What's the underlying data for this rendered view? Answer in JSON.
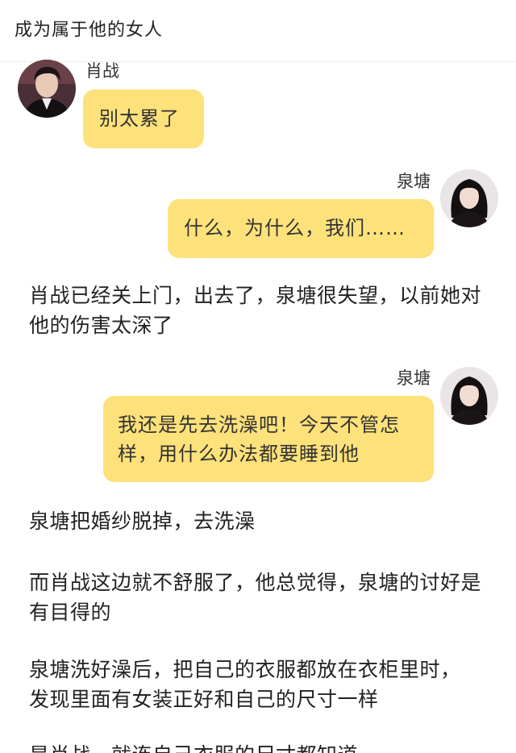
{
  "header": {
    "title": "成为属于他的女人"
  },
  "messages": [
    {
      "name": "肖战",
      "text": "别太累了",
      "avatar_icon": "male-portrait-avatar"
    },
    {
      "name": "泉塘",
      "text": "什么，为什么，我们……",
      "avatar_icon": "female-portrait-avatar"
    },
    {
      "name": "泉塘",
      "text": "我还是先去洗澡吧！今天不管怎样，用什么办法都要睡到他",
      "avatar_icon": "female-portrait-avatar"
    }
  ],
  "narration": [
    "肖战已经关上门，出去了，泉塘很失望，以前她对他的伤害太深了",
    "泉塘把婚纱脱掉，去洗澡",
    "而肖战这边就不舒服了，他总觉得，泉塘的讨好是有目得的",
    "泉塘洗好澡后，把自己的衣服都放在衣柜里时，发现里面有女装正好和自己的尺寸一样",
    "是肖战，就连自己衣服的尺寸都知道"
  ],
  "colors": {
    "bubble": "#fde17a",
    "text": "#222222",
    "divider": "#ececec"
  }
}
